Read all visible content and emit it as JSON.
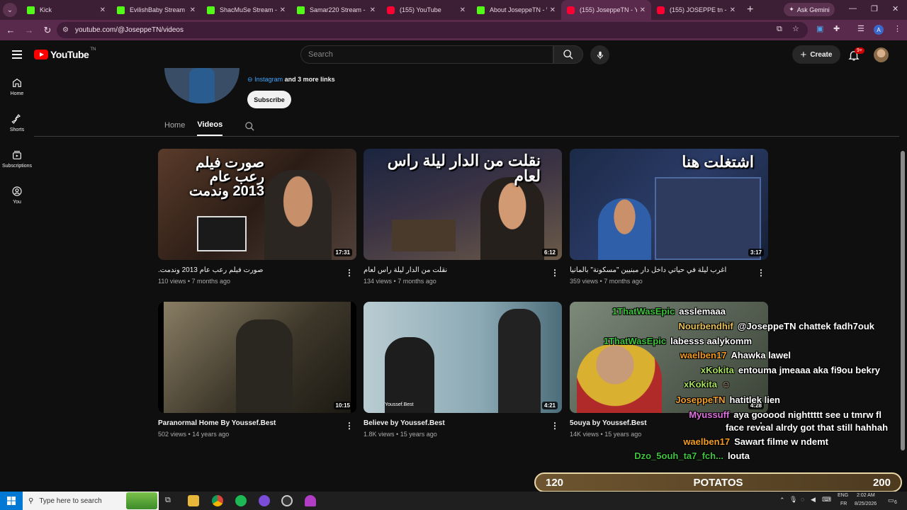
{
  "browser": {
    "tabs": [
      {
        "title": "Kick",
        "favicon": "kick",
        "active": false
      },
      {
        "title": "EvilishBaby Stream - W",
        "favicon": "kick",
        "active": false
      },
      {
        "title": "ShacMuSe Stream - W",
        "favicon": "kick",
        "active": false
      },
      {
        "title": "Samar220 Stream - W",
        "favicon": "kick",
        "active": false
      },
      {
        "title": "(155) YouTube",
        "favicon": "yt",
        "active": false
      },
      {
        "title": "About JoseppeTN - W",
        "favicon": "kick",
        "active": false
      },
      {
        "title": "(155) JoseppeTN - You",
        "favicon": "yt",
        "active": true
      },
      {
        "title": "(155) JOSEPPE tn - You",
        "favicon": "yt",
        "active": false
      }
    ],
    "gemini_label": "Ask Gemini",
    "url": "youtube.com/@JoseppeTN/videos",
    "profile_letter": "A"
  },
  "youtube": {
    "logo_text": "YouTube",
    "country_code": "TN",
    "search_placeholder": "Search",
    "create_label": "Create",
    "notification_count": "9+",
    "guide": [
      {
        "label": "Home",
        "icon": "home-icon"
      },
      {
        "label": "Shorts",
        "icon": "shorts-icon"
      },
      {
        "label": "Subscriptions",
        "icon": "subscriptions-icon"
      },
      {
        "label": "You",
        "icon": "you-icon"
      }
    ],
    "channel": {
      "link_text": "Instagram",
      "more_links": "and 3 more links",
      "subscribe_label": "Subscribe",
      "tabs": [
        {
          "label": "Home",
          "active": false
        },
        {
          "label": "Videos",
          "active": true
        }
      ]
    },
    "videos": [
      {
        "title": "صورت فيلم رعب عام 2013 وندمت.",
        "views": "110 views",
        "age": "7 months ago",
        "duration": "17:31",
        "thumb_text": "صورت فيلم رعب عام 2013 وندمت"
      },
      {
        "title": "نقلت من الدار ليلة راس لعام",
        "views": "134 views",
        "age": "7 months ago",
        "duration": "6:12",
        "thumb_text": "نقلت من الدار ليلة راس لعام"
      },
      {
        "title": "أغرب ليلة في حياتي داخل دار مبنيين \"مسكونة\" بألمانيا",
        "views": "359 views",
        "age": "7 months ago",
        "duration": "3:17",
        "thumb_text": "اشتغلت هنا"
      },
      {
        "title": "Paranormal Home By Youssef.Best",
        "views": "502 views",
        "age": "14 years ago",
        "duration": "10:15",
        "thumb_text": ""
      },
      {
        "title": "Believe by Youssef.Best",
        "views": "1.8K views",
        "age": "15 years ago",
        "duration": "4:21",
        "thumb_text": "Youssef.Best"
      },
      {
        "title": "5ouya by Youssef.Best",
        "views": "14K views",
        "age": "15 years ago",
        "duration": "4:28",
        "thumb_text": ""
      }
    ]
  },
  "stream_overlay": {
    "chat": [
      {
        "name": "1ThatWasEpic",
        "message": "asslemaaa",
        "color": "#3ec43e"
      },
      {
        "name": "Nourbendhif",
        "message": "@JoseppeTN chattek fadh7ouk",
        "color": "#e6c15a"
      },
      {
        "name": "1ThatWasEpic",
        "message": "labesss aalykomm",
        "color": "#3ec43e"
      },
      {
        "name": "waelben17",
        "message": "Ahawka lawel",
        "color": "#f39c1f"
      },
      {
        "name": "xKokita",
        "message": "entouma jmeaaa aka fi9ou bekry",
        "color": "#a5e05a"
      },
      {
        "name": "xKokita",
        "message": "",
        "color": "#a5e05a"
      },
      {
        "name": "JoseppeTN",
        "message": "hatitlek lien",
        "color": "#f0a030"
      },
      {
        "name": "Myussuff",
        "message": "aya gooood nighttttt see u tmrw fl",
        "color": "#e070e0"
      },
      {
        "name": "",
        "message": "face reveal alrdy got that still hahhah",
        "color": "#ffffff"
      },
      {
        "name": "waelben17",
        "message": "Sawart filme w ndemt",
        "color": "#f39c1f"
      },
      {
        "name": "Dzo_5ouh_ta7_fch...",
        "message": "louta",
        "color": "#3ec43e"
      }
    ],
    "goal": {
      "left": "120",
      "label": "POTATOS",
      "right": "200"
    }
  },
  "taskbar": {
    "search_placeholder": "Type here to search",
    "lang": "ENG",
    "lang2": "FR",
    "time": "2:02 AM",
    "date": "8/25/2026",
    "notif": "6"
  }
}
